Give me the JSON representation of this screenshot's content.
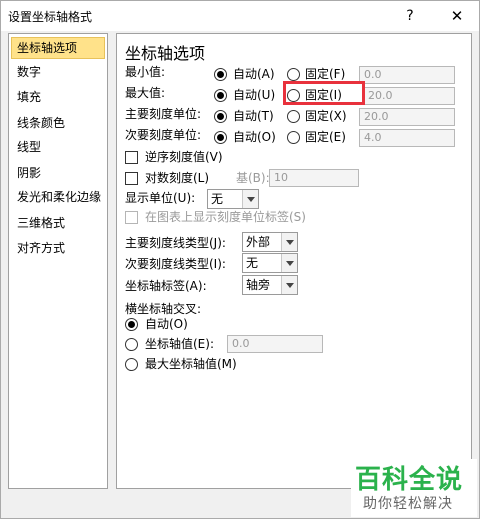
{
  "window": {
    "title": "设置坐标轴格式",
    "help": "?",
    "close": "✕"
  },
  "sidebar": {
    "items": [
      {
        "label": "坐标轴选项",
        "active": true
      },
      {
        "label": "数字"
      },
      {
        "label": "填充"
      },
      {
        "label": "线条颜色"
      },
      {
        "label": "线型"
      },
      {
        "label": "阴影"
      },
      {
        "label": "发光和柔化边缘"
      },
      {
        "label": "三维格式"
      },
      {
        "label": "对齐方式"
      }
    ]
  },
  "panel": {
    "title": "坐标轴选项",
    "min": {
      "label": "最小值:",
      "auto": "自动(A)",
      "fixed": "固定(F)",
      "value": "0.0"
    },
    "max": {
      "label": "最大值:",
      "auto": "自动(U)",
      "fixed": "固定(I)",
      "value": "20.0"
    },
    "major_unit": {
      "label": "主要刻度单位:",
      "auto": "自动(T)",
      "fixed": "固定(X)",
      "value": "20.0"
    },
    "minor_unit": {
      "label": "次要刻度单位:",
      "auto": "自动(O)",
      "fixed": "固定(E)",
      "value": "4.0"
    },
    "reverse": {
      "label": "逆序刻度值(V)"
    },
    "log": {
      "label": "对数刻度(L)",
      "base_label": "基(B):",
      "base_value": "10"
    },
    "display_units": {
      "label": "显示单位(U):",
      "value": "无"
    },
    "show_units_label": {
      "label": "在图表上显示刻度单位标签(S)"
    },
    "major_tick": {
      "label": "主要刻度线类型(J):",
      "value": "外部"
    },
    "minor_tick": {
      "label": "次要刻度线类型(I):",
      "value": "无"
    },
    "axis_labels": {
      "label": "坐标轴标签(A):",
      "value": "轴旁"
    },
    "cross": {
      "label": "横坐标轴交叉:",
      "auto": "自动(O)",
      "value_label": "坐标轴值(E):",
      "value": "0.0",
      "max": "最大坐标轴值(M)"
    }
  },
  "watermark": {
    "main": "百科全说",
    "sub": "助你轻松解决"
  }
}
